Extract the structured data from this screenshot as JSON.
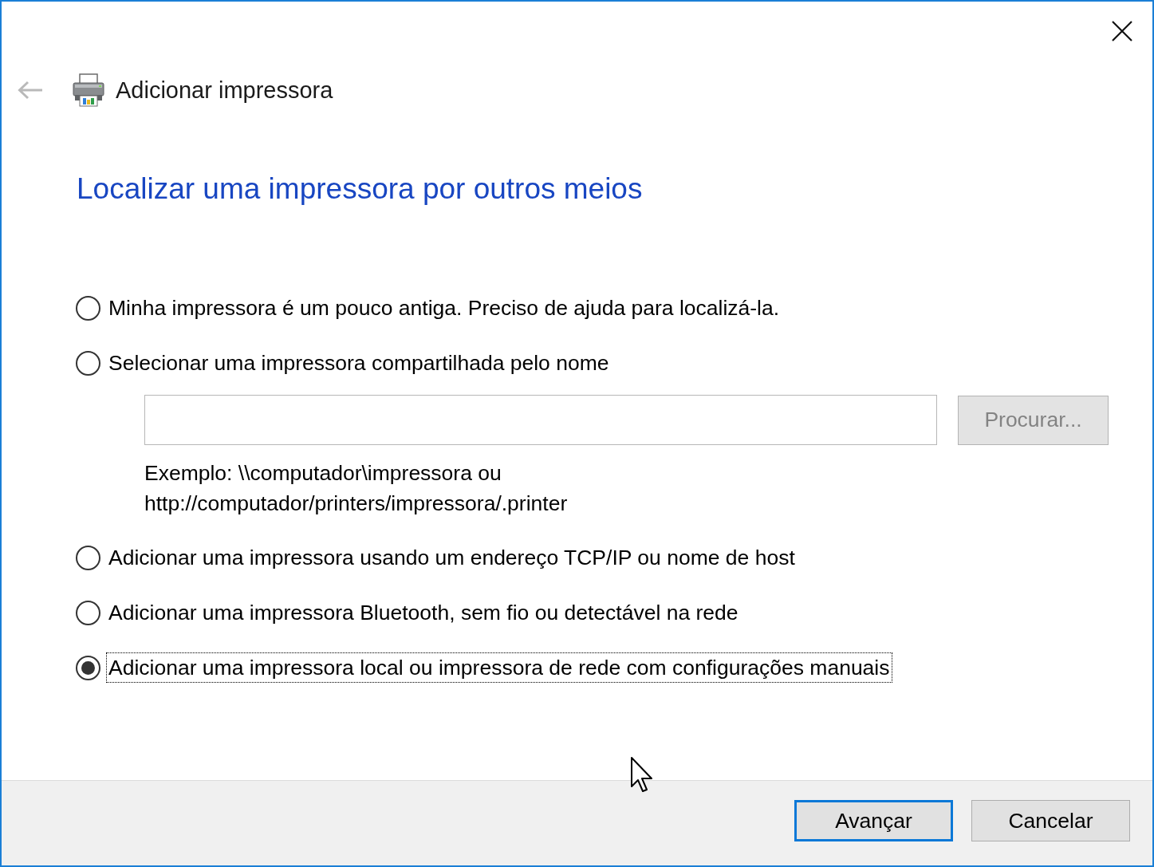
{
  "window": {
    "title": "Adicionar impressora",
    "back_button": {
      "disabled": true
    }
  },
  "heading": "Localizar uma impressora por outros meios",
  "options": [
    {
      "kind": "plain",
      "label": "Minha impressora é um pouco antiga. Preciso de ajuda para localizá-la.",
      "selected": false,
      "focused": false
    },
    {
      "kind": "share_path",
      "label": "Selecionar uma impressora compartilhada pelo nome",
      "selected": false,
      "focused": false,
      "browse_button": {
        "label": "Procurar...",
        "disabled": true
      },
      "example": "Exemplo: \\\\computador\\impressora ou\nhttp://computador/printers/impressora/.printer"
    },
    {
      "kind": "plain",
      "label": "Adicionar uma impressora usando um endereço TCP/IP ou nome de host",
      "selected": false,
      "focused": false
    },
    {
      "kind": "plain",
      "label": "Adicionar uma impressora Bluetooth, sem fio ou detectável na rede",
      "selected": false,
      "focused": false
    },
    {
      "kind": "plain",
      "label": "Adicionar uma impressora local ou impressora de rede com configurações manuais",
      "selected": true,
      "focused": true
    }
  ],
  "buttons": [
    {
      "label": "Avançar",
      "default": true
    },
    {
      "label": "Cancelar",
      "default": false
    }
  ]
}
